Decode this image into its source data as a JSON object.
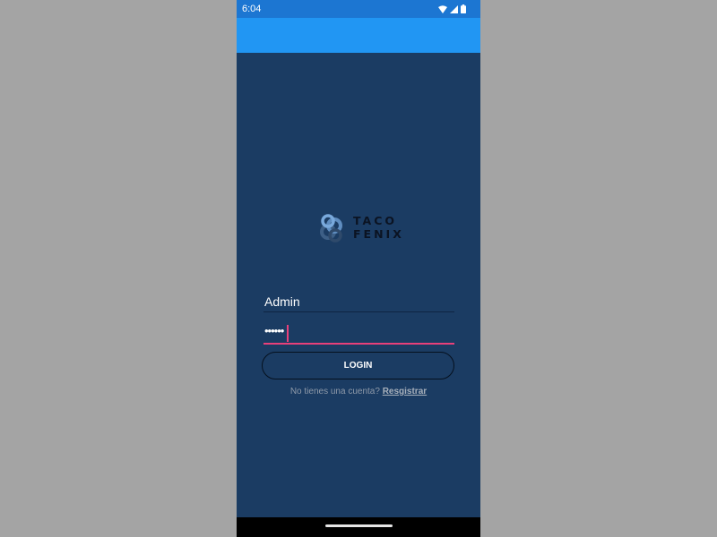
{
  "status_bar": {
    "time": "6:04",
    "icons": [
      "wifi-icon",
      "signal-icon",
      "battery-icon"
    ]
  },
  "logo": {
    "line1": "TACO",
    "line2": "FENIX",
    "icon": "taco-fenix-logo-icon"
  },
  "login_form": {
    "username_value": "Admin",
    "password_value": "••••••",
    "login_button_label": "LOGIN"
  },
  "register": {
    "prompt": "No tienes una cuenta?",
    "link_label": "Resgistrar"
  },
  "colors": {
    "status_bar": "#1c76d2",
    "app_bar": "#2196f3",
    "screen_background": "#1b3c63",
    "accent": "#e8407a"
  }
}
